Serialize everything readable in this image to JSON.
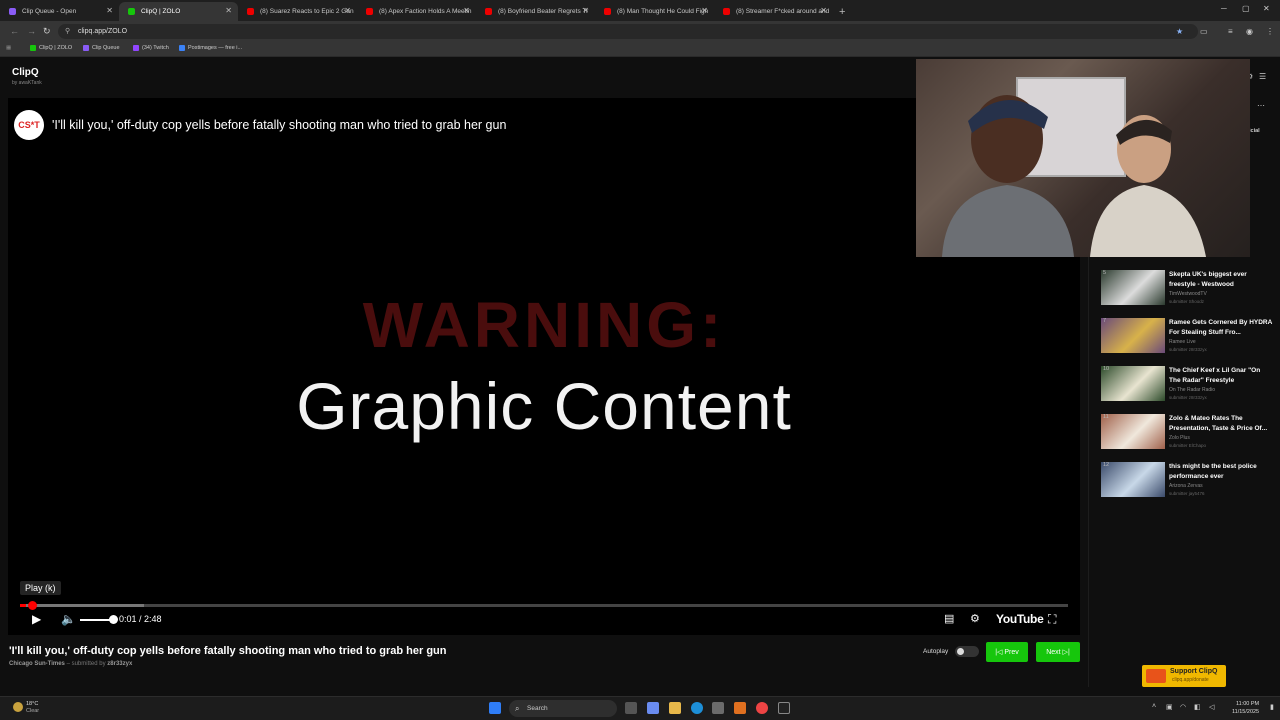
{
  "browser": {
    "tabs": [
      {
        "label": "Clip Queue - Open",
        "favicon_color": "#8a5cf6",
        "active": false
      },
      {
        "label": "ClipQ | ZOLO",
        "favicon_color": "#16c60c",
        "active": true
      },
      {
        "label": "(8) Suarez Reacts to Epic 2 Gan",
        "favicon_color": "#e00",
        "active": false
      },
      {
        "label": "(8) Apex Faction Holds A Meetin",
        "favicon_color": "#e00",
        "active": false
      },
      {
        "label": "(8) Boyfriend Beater Regrets Tr",
        "favicon_color": "#e00",
        "active": false
      },
      {
        "label": "(8) Man Thought He Could Figh",
        "favicon_color": "#e00",
        "active": false
      },
      {
        "label": "(8) Streamer F*cked around and",
        "favicon_color": "#e00",
        "active": false
      }
    ],
    "url": "clipq.app/ZOLO",
    "bookmarks": [
      {
        "label": "ClipQ | ZOLO",
        "color": "#16c60c"
      },
      {
        "label": "Clip Queue",
        "color": "#8a5cf6"
      },
      {
        "label": "(34) Twitch",
        "color": "#9146ff"
      },
      {
        "label": "Postimages — free i...",
        "color": "#3b82f6"
      }
    ]
  },
  "app": {
    "title": "ClipQ",
    "subtitle": "by awaKTank"
  },
  "video": {
    "channel_logo": "CS*T",
    "title": "'I'll kill you,' off-duty cop yells before fatally shooting man who tried to grab her gun",
    "warning_text": "WARNING:",
    "graphic_text": "Graphic Content",
    "tooltip": "Play (k)",
    "time": "0:01 / 2:48",
    "played_fraction": 0.006,
    "youtube_label": "YouTube"
  },
  "clip": {
    "title": "'I'll kill you,' off-duty cop yells before fatally shooting man who tried to grab her gun",
    "channel": "Chicago Sun-Times",
    "submitted_prefix": "– submitted by",
    "submitter": "z8r33zyx",
    "autoplay_label": "Autoplay",
    "prev_label": "|◁ Prev",
    "next_label": "Next ▷|"
  },
  "sidebar": {
    "partial_label": "icial",
    "items": [
      {
        "num": "5",
        "title": "Skepta UK's biggest ever freestyle - Westwood",
        "channel": "TimWestwoodTV",
        "submitter": "submitter Shoodz"
      },
      {
        "num": "7",
        "title": "Ramee Gets Cornered By HYDRA For Stealing Stuff Fro...",
        "channel": "Ramee Live",
        "submitter": "submitter z8r33zyx"
      },
      {
        "num": "10",
        "title": "The Chief Keef x Lil Gnar \"On The Radar\" Freestyle",
        "channel": "On The Radar Radio",
        "submitter": "submitter z8r33zyx"
      },
      {
        "num": "11",
        "title": "Zolo & Mateo Rates The Presentation, Taste & Price Of...",
        "channel": "Zolo Plus",
        "submitter": "submitter ElChapo"
      },
      {
        "num": "12",
        "title": "this might be the best police performance ever",
        "channel": "Arizona Zervas",
        "submitter": "submitter jay5476"
      }
    ],
    "support_label": "Support ClipQ",
    "support_sub": "clipq.app/donate"
  },
  "taskbar": {
    "temp": "18°C",
    "weather": "Clear",
    "search_placeholder": "Search",
    "time": "11:00 PM",
    "date": "11/15/2025"
  }
}
